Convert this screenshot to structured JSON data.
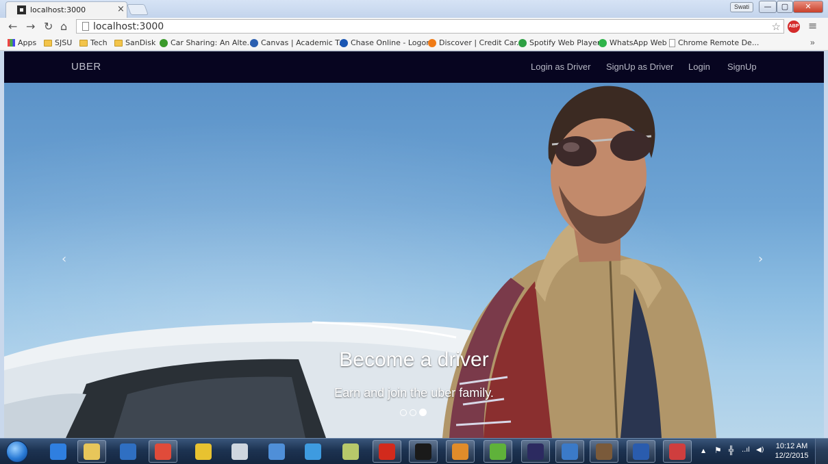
{
  "browser": {
    "tab_title": "localhost:3000",
    "tab_close": "×",
    "user_badge": "Swati",
    "window_buttons": {
      "minimize": "—",
      "maximize": "▢",
      "close": "✕"
    },
    "url": "localhost:3000",
    "bookmarks": [
      {
        "label": "Apps",
        "icon": "apps-grid-icon"
      },
      {
        "label": "SJSU",
        "icon": "folder-icon"
      },
      {
        "label": "Tech",
        "icon": "folder-icon"
      },
      {
        "label": "SanDisk",
        "icon": "folder-icon"
      },
      {
        "label": "Car Sharing: An Alte...",
        "icon": "zotero-icon",
        "color": "#3b9a2b"
      },
      {
        "label": "Canvas | Academic T...",
        "icon": "canvas-icon",
        "color": "#2b5fb0"
      },
      {
        "label": "Chase Online - Logon",
        "icon": "chase-icon",
        "color": "#1a56b3"
      },
      {
        "label": "Discover | Credit Car...",
        "icon": "discover-icon",
        "color": "#f07b16"
      },
      {
        "label": "Spotify Web Player",
        "icon": "spotify-icon",
        "color": "#2ea043"
      },
      {
        "label": "WhatsApp Web",
        "icon": "whatsapp-icon",
        "color": "#2fb44a"
      },
      {
        "label": "Chrome Remote De...",
        "icon": "page-icon"
      }
    ],
    "bookmarks_more": "»"
  },
  "site": {
    "brand": "UBER",
    "nav": {
      "login_driver": "Login as Driver",
      "signup_driver": "SignUp as Driver",
      "login": "Login",
      "signup": "SignUp"
    },
    "carousel": {
      "prev": "‹",
      "next": "›",
      "caption_title": "Become a driver",
      "caption_text": "Earn and join the uber family.",
      "slide_count": 3,
      "active_slide": 3
    }
  },
  "taskbar": {
    "apps": [
      {
        "name": "internet-explorer-icon",
        "color": "#2f7fe0"
      },
      {
        "name": "file-explorer-icon",
        "color": "#e8c65a"
      },
      {
        "name": "outlook-icon",
        "color": "#2f6fc2"
      },
      {
        "name": "chrome-icon",
        "color": "#e04b3a"
      },
      {
        "name": "network-tool-icon",
        "color": "#e8c230"
      },
      {
        "name": "pen-tool-icon",
        "color": "#cfd6df"
      },
      {
        "name": "remote-desktop-icon",
        "color": "#4f8fd8"
      },
      {
        "name": "chat-icon",
        "color": "#3e9be0"
      },
      {
        "name": "setup-icon",
        "color": "#b7c86a"
      },
      {
        "name": "acrobat-icon",
        "color": "#d22a1c"
      },
      {
        "name": "command-prompt-icon",
        "color": "#1a1a1a"
      },
      {
        "name": "sublime-text-icon",
        "color": "#e08c2a"
      },
      {
        "name": "evernote-icon",
        "color": "#5fb23a"
      },
      {
        "name": "eclipse-icon",
        "color": "#2c2a60"
      },
      {
        "name": "diagram-tool-icon",
        "color": "#3b7ac8"
      },
      {
        "name": "aws-settings-icon",
        "color": "#7a5a3a"
      },
      {
        "name": "word-icon",
        "color": "#2a5cae"
      },
      {
        "name": "snipping-tool-icon",
        "color": "#cf3e3e"
      }
    ],
    "tray": {
      "expand": "▲",
      "flag": "⚑",
      "network": "╬",
      "signal": "..ıl",
      "volume": "◀)"
    },
    "time": "10:12 AM",
    "date": "12/2/2015"
  }
}
